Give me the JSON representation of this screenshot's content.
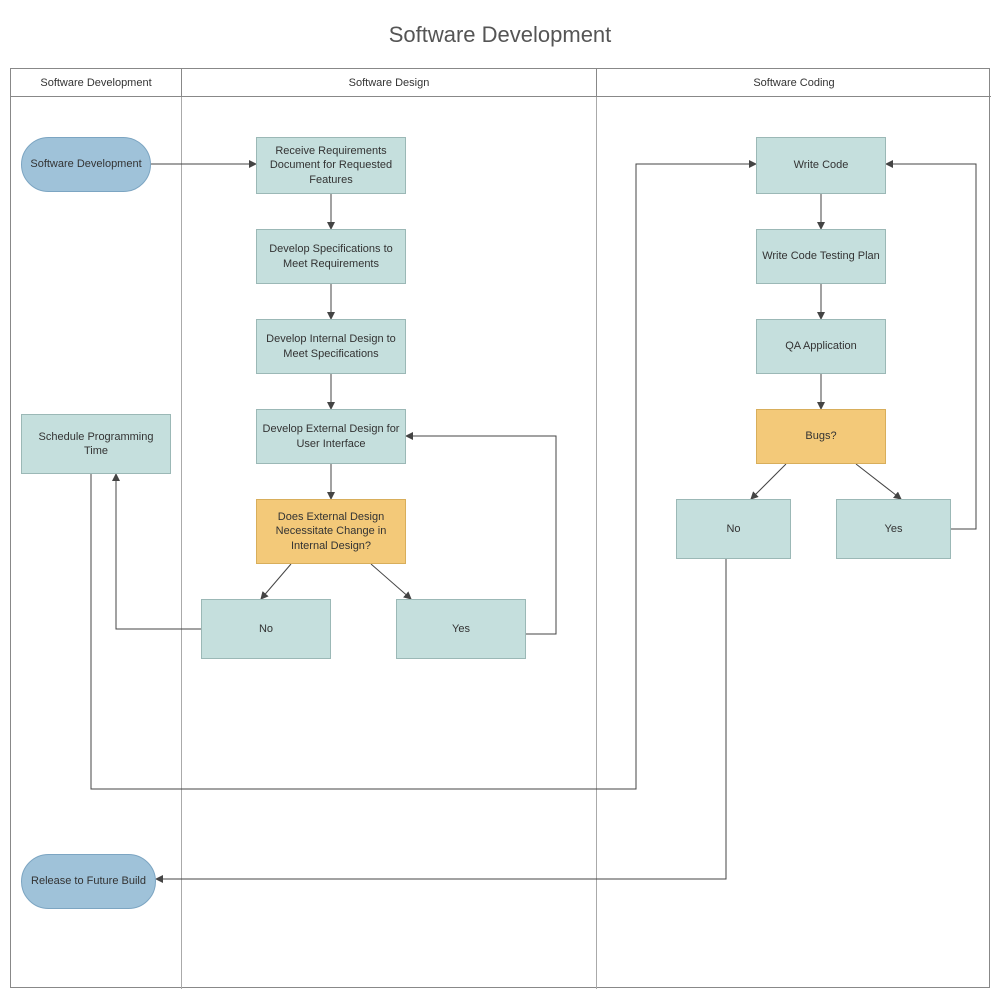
{
  "title": "Software Development",
  "swimlanes": {
    "lane1": "Software Development",
    "lane2": "Software Design",
    "lane3": "Software Coding"
  },
  "nodes": {
    "start": "Software Development",
    "receive": "Receive Requirements Document for Requested Features",
    "specs": "Develop Specifications to Meet Requirements",
    "internal": "Develop Internal Design to Meet Specifications",
    "external": "Develop External Design for User Interface",
    "design_change_q": "Does External Design Necessitate Change in Internal Design?",
    "design_no": "No",
    "design_yes": "Yes",
    "schedule": "Schedule Programming Time",
    "write_code": "Write Code",
    "test_plan": "Write  Code Testing Plan",
    "qa": "QA Application",
    "bugs_q": "Bugs?",
    "bugs_no": "No",
    "bugs_yes": "Yes",
    "release": "Release to Future Build"
  }
}
